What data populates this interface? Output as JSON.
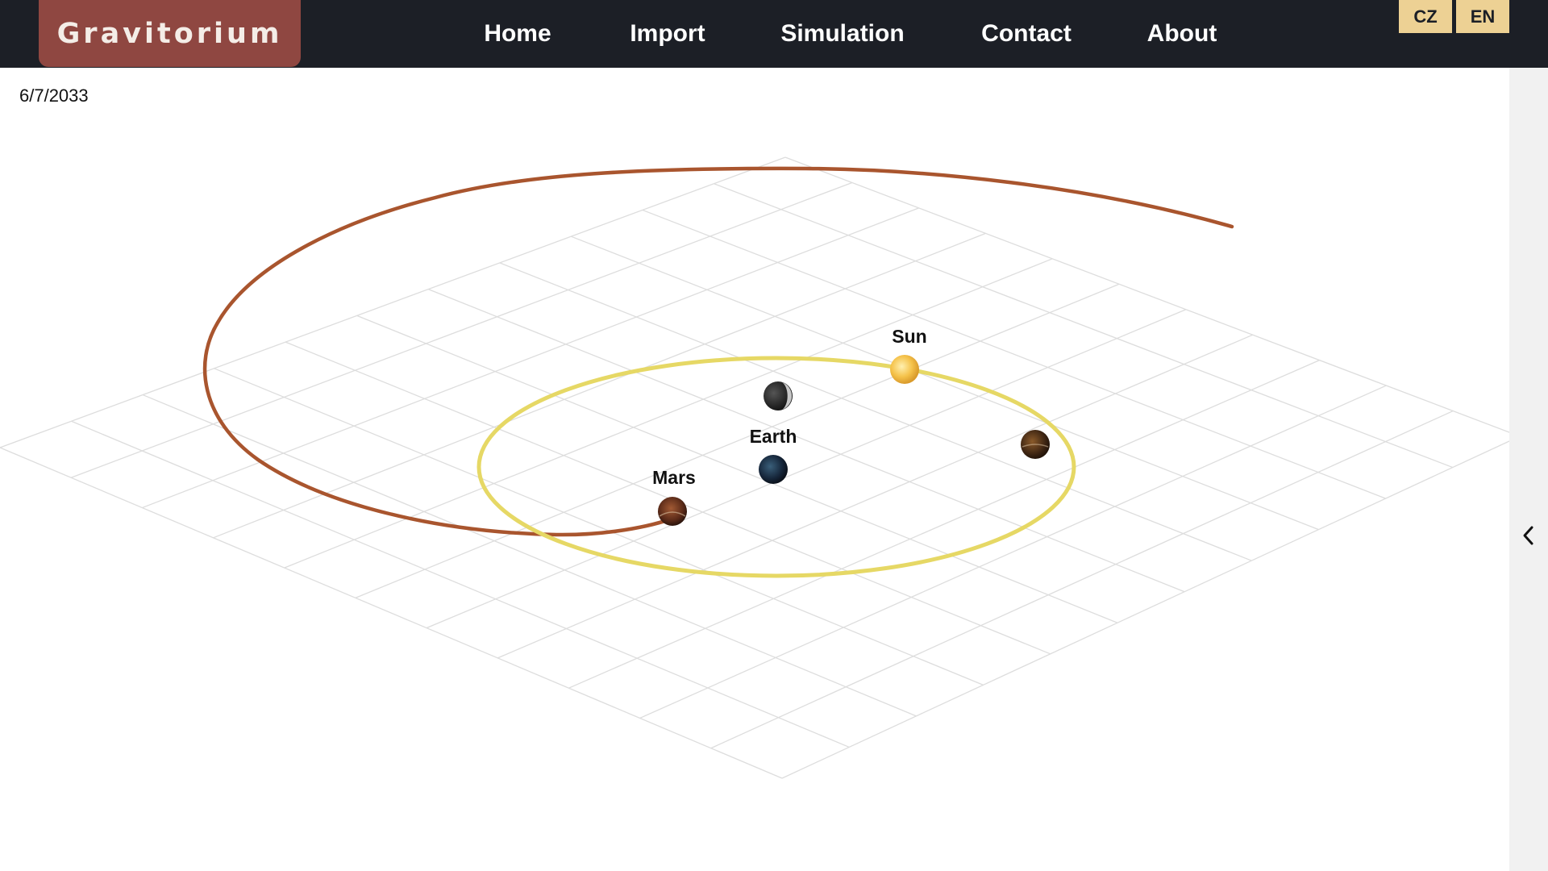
{
  "app": {
    "logo": "Gravitorium"
  },
  "nav": {
    "items": [
      "Home",
      "Import",
      "Simulation",
      "Contact",
      "About"
    ]
  },
  "languages": {
    "cz": "CZ",
    "en": "EN"
  },
  "simulation": {
    "date": "6/7/2033",
    "bodies": {
      "sun": "Sun",
      "earth": "Earth",
      "mars": "Mars"
    }
  },
  "icons": {
    "side_toggle": "chevron-left-icon"
  },
  "colors": {
    "navbar": "#1c1f26",
    "logo_bg": "#8f4741",
    "lang_bg": "#edd194",
    "mars_orbit": "#a9552e",
    "earth_orbit": "#e6d865",
    "grid": "#dddddd"
  }
}
